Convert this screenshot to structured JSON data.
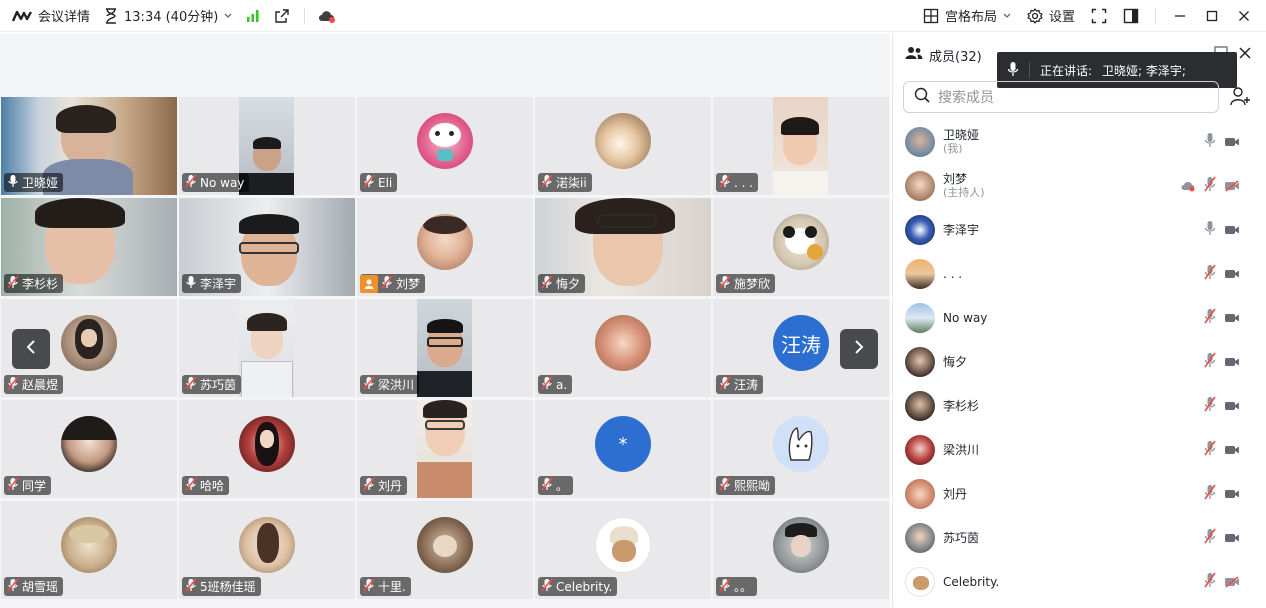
{
  "topbar": {
    "meeting_info_label": "会议详情",
    "duration_label": "13:34 (40分钟)",
    "layout_label": "宫格布局",
    "settings_label": "设置"
  },
  "speaking": {
    "label": "正在讲话:",
    "names": "卫晓娅; 李泽宇;"
  },
  "sidebar": {
    "title": "成员(32)",
    "search_placeholder": "搜索成员"
  },
  "tiles": [
    {
      "name": "卫晓娅"
    },
    {
      "name": "No way"
    },
    {
      "name": "Eli"
    },
    {
      "name": "渃柒ii"
    },
    {
      "name": ". . ."
    },
    {
      "name": "李杉杉"
    },
    {
      "name": "李泽宇"
    },
    {
      "name": "刘梦"
    },
    {
      "name": "悔夕"
    },
    {
      "name": "施梦欣"
    },
    {
      "name": "赵晨煜"
    },
    {
      "name": "苏巧茵"
    },
    {
      "name": "梁洪川"
    },
    {
      "name": "a."
    },
    {
      "name": "汪涛",
      "initials": "汪涛"
    },
    {
      "name": "同学"
    },
    {
      "name": "哈哈"
    },
    {
      "name": "刘丹"
    },
    {
      "name": "。",
      "initials": "*"
    },
    {
      "name": "熙熙呦"
    },
    {
      "name": "胡雪瑶"
    },
    {
      "name": "5班杨佳瑶"
    },
    {
      "name": "十里."
    },
    {
      "name": "Celebrity."
    },
    {
      "name": "。。"
    }
  ],
  "members": [
    {
      "name": "卫晓娅",
      "sub": "(我)"
    },
    {
      "name": "刘梦",
      "sub": "(主持人)"
    },
    {
      "name": "李泽宇",
      "sub": ""
    },
    {
      "name": ". . .",
      "sub": ""
    },
    {
      "name": "No way",
      "sub": ""
    },
    {
      "name": "悔夕",
      "sub": ""
    },
    {
      "name": "李杉杉",
      "sub": ""
    },
    {
      "name": "梁洪川",
      "sub": ""
    },
    {
      "name": "刘丹",
      "sub": ""
    },
    {
      "name": "苏巧茵",
      "sub": ""
    },
    {
      "name": "Celebrity.",
      "sub": ""
    }
  ],
  "colors": {
    "active_border": "#3bc48b",
    "host_badge": "#f0902a",
    "muted_red": "#f54a45",
    "signal_green": "#34c724"
  }
}
